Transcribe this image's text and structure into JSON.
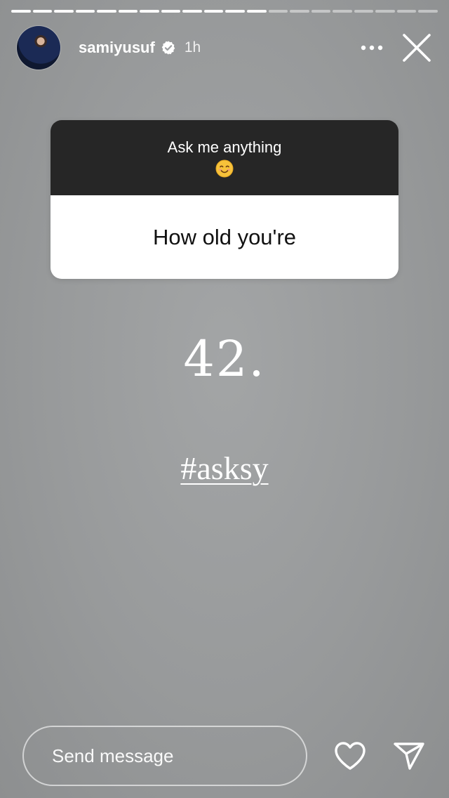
{
  "story": {
    "username": "samiyusuf",
    "verified": true,
    "time_ago": "1h",
    "segments_total": 20,
    "segments_done": 12
  },
  "header": {
    "avatar_icon": "profile-photo",
    "verified_icon": "verified-badge-icon",
    "more_icon": "more-horizontal-icon",
    "more_label": "•••",
    "close_icon": "close-icon"
  },
  "sticker": {
    "prompt": "Ask me anything",
    "emoji_icon": "smiling-face-emoji",
    "question": "How old you're"
  },
  "content": {
    "reply": "42.",
    "hashtag": "#asksy"
  },
  "footer": {
    "message_placeholder": "Send message",
    "like_icon": "heart-icon",
    "share_icon": "send-icon"
  },
  "colors": {
    "background": "#999b9c",
    "sticker_header": "#262626",
    "sticker_body": "#ffffff",
    "text": "#ffffff"
  }
}
